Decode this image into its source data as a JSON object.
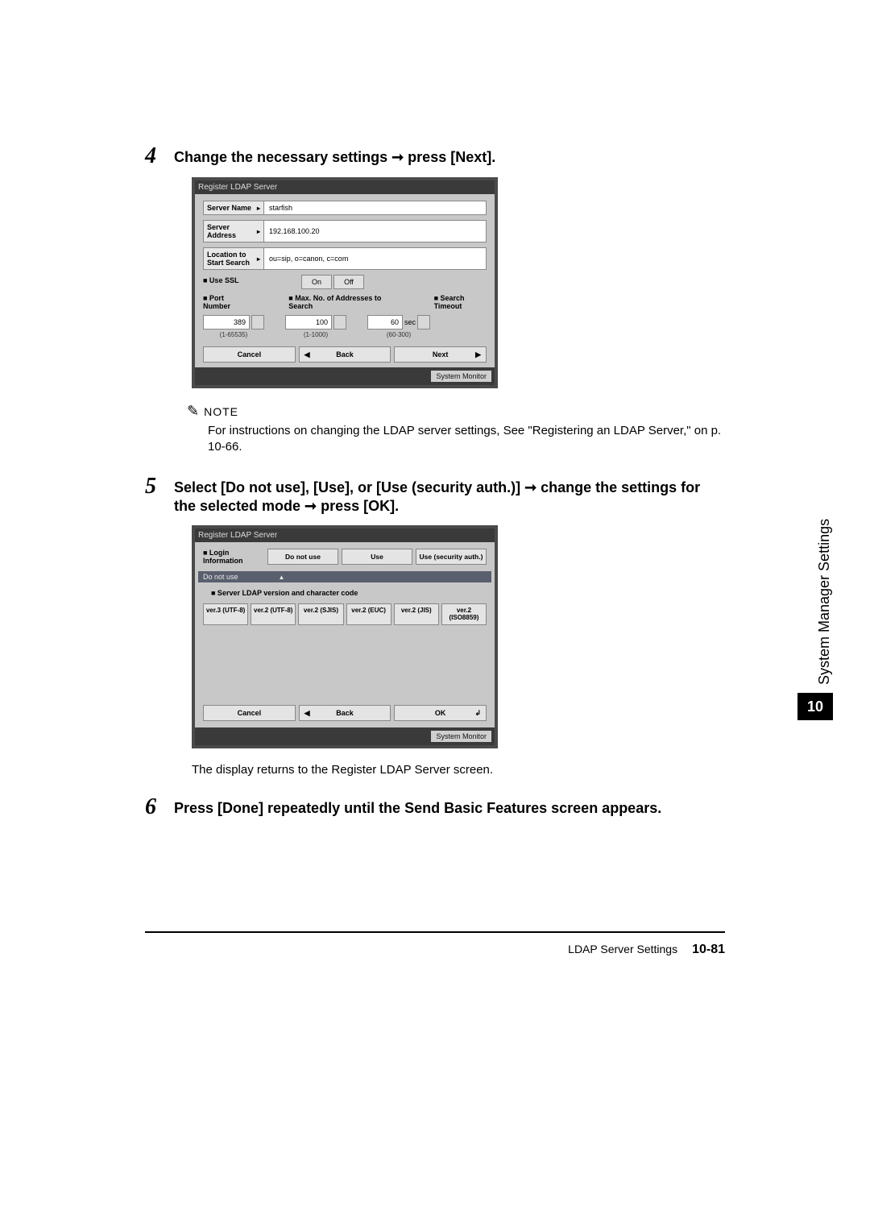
{
  "sideTab": "System Manager Settings",
  "chapter": "10",
  "footer": {
    "section": "LDAP Server Settings",
    "page": "10-81"
  },
  "step4": {
    "num": "4",
    "text": "Change the necessary settings ➞ press [Next].",
    "screen": {
      "title": "Register LDAP Server",
      "serverNameLabel": "Server Name",
      "serverName": "starfish",
      "serverAddrLabel": "Server Address",
      "serverAddr": "192.168.100.20",
      "locLabel": "Location to Start Search",
      "loc": "ou=sip, o=canon, c=com",
      "useSSL": "■ Use SSL",
      "on": "On",
      "off": "Off",
      "portLabel": "■ Port Number",
      "port": "389",
      "portRange": "(1-65535)",
      "maxLabel": "■ Max. No. of Addresses to Search",
      "max": "100",
      "maxRange": "(1-1000)",
      "timeoutLabel": "■ Search Timeout",
      "timeout": "60",
      "sec": "sec",
      "timeoutRange": "(60-300)",
      "cancel": "Cancel",
      "back": "Back",
      "next": "Next",
      "sysmon": "System Monitor"
    }
  },
  "note": {
    "label": "NOTE",
    "body": "For instructions on changing the LDAP server settings, See \"Registering an LDAP Server,\" on p. 10-66."
  },
  "step5": {
    "num": "5",
    "text": "Select [Do not use], [Use], or [Use (security auth.)] ➞ change the settings for the selected mode ➞ press [OK].",
    "screen": {
      "title": "Register LDAP Server",
      "loginLabel": "■ Login Information",
      "opts": [
        "Do not use",
        "Use",
        "Use (security auth.)"
      ],
      "hint": "Do not use",
      "sub": "■ Server LDAP version and character code",
      "vers": [
        "ver.3 (UTF-8)",
        "ver.2 (UTF-8)",
        "ver.2 (SJIS)",
        "ver.2 (EUC)",
        "ver.2 (JIS)",
        "ver.2 (ISO8859)"
      ],
      "cancel": "Cancel",
      "back": "Back",
      "ok": "OK",
      "sysmon": "System Monitor"
    }
  },
  "returnText": "The display returns to the Register LDAP Server screen.",
  "step6": {
    "num": "6",
    "text": "Press [Done] repeatedly until the Send Basic Features screen appears."
  }
}
